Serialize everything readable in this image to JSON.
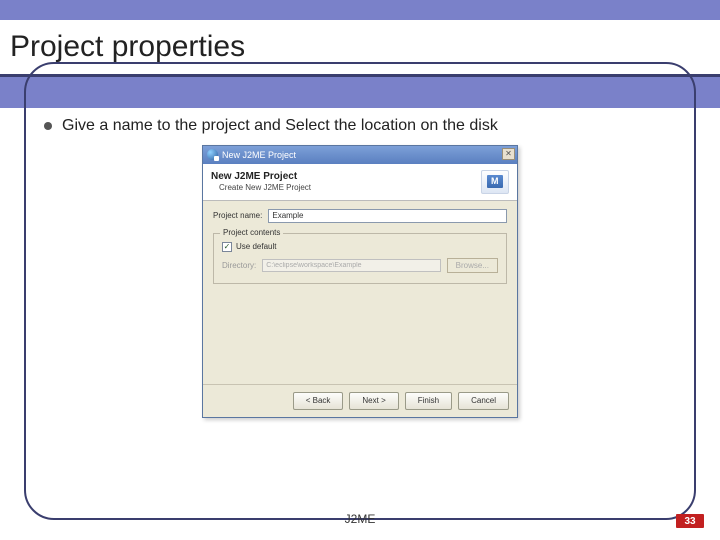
{
  "slide": {
    "title": "Project properties",
    "bullet": "Give a name to the project and Select the location on the disk",
    "footer": "J2ME",
    "page_number": "33"
  },
  "dialog": {
    "window_title": "New J2ME Project",
    "header_title": "New J2ME Project",
    "header_subtitle": "Create New J2ME Project",
    "name_label": "Project name:",
    "name_value": "Example",
    "group_legend": "Project contents",
    "checkbox_label": "Use default",
    "checkbox_checked": "✓",
    "directory_label": "Directory:",
    "directory_value": "C:\\eclipse\\workspace\\Example",
    "browse_label": "Browse...",
    "close_glyph": "✕",
    "buttons": {
      "back": "< Back",
      "next": "Next >",
      "finish": "Finish",
      "cancel": "Cancel"
    }
  }
}
